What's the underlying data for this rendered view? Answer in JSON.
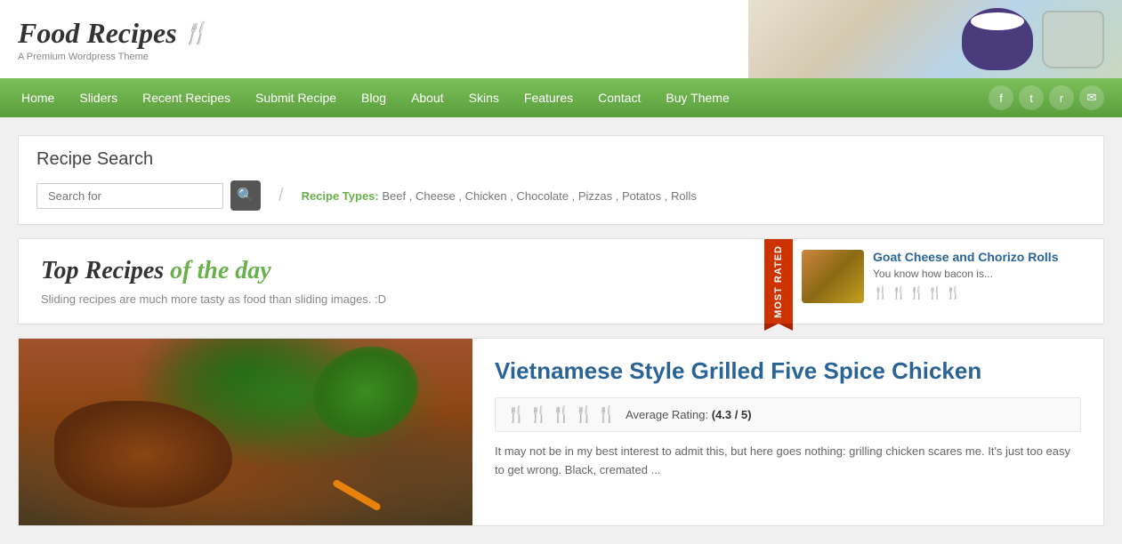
{
  "site": {
    "title": "Food Recipes",
    "subtitle": "A Premium Wordpress Theme",
    "icon": "🍴"
  },
  "nav": {
    "items": [
      {
        "label": "Home",
        "id": "home"
      },
      {
        "label": "Sliders",
        "id": "sliders"
      },
      {
        "label": "Recent Recipes",
        "id": "recent-recipes"
      },
      {
        "label": "Submit Recipe",
        "id": "submit-recipe"
      },
      {
        "label": "Blog",
        "id": "blog"
      },
      {
        "label": "About",
        "id": "about"
      },
      {
        "label": "Skins",
        "id": "skins"
      },
      {
        "label": "Features",
        "id": "features"
      },
      {
        "label": "Contact",
        "id": "contact"
      },
      {
        "label": "Buy Theme",
        "id": "buy-theme"
      }
    ],
    "socials": [
      {
        "icon": "f",
        "name": "facebook"
      },
      {
        "icon": "t",
        "name": "twitter"
      },
      {
        "icon": "r",
        "name": "rss"
      },
      {
        "icon": "e",
        "name": "email"
      }
    ]
  },
  "search": {
    "title": "Recipe Search",
    "placeholder": "Search for",
    "recipe_types_label": "Recipe Types:",
    "recipe_types": [
      "Beef",
      "Cheese",
      "Chicken",
      "Chocolate",
      "Pizzas",
      "Potatos",
      "Rolls"
    ]
  },
  "top_recipes": {
    "title_part1": "Top Recipes",
    "title_part2": "of the day",
    "description": "Sliding recipes are much more tasty as food than sliding images. :D"
  },
  "most_rated": {
    "ribbon_text": "Most Rated",
    "recipe_title": "Goat Cheese and Chorizo Rolls",
    "recipe_desc": "You know how bacon is...",
    "rating": 4,
    "max_rating": 5
  },
  "featured_recipe": {
    "title": "Vietnamese Style Grilled Five Spice Chicken",
    "rating": 4.3,
    "max_rating": 5,
    "rating_label": "Average Rating:",
    "rating_display": "(4.3 / 5)",
    "excerpt": "It may not be in my best interest to admit this, but here goes nothing: grilling chicken scares me. It's just too easy to get wrong. Black, cremated ..."
  }
}
